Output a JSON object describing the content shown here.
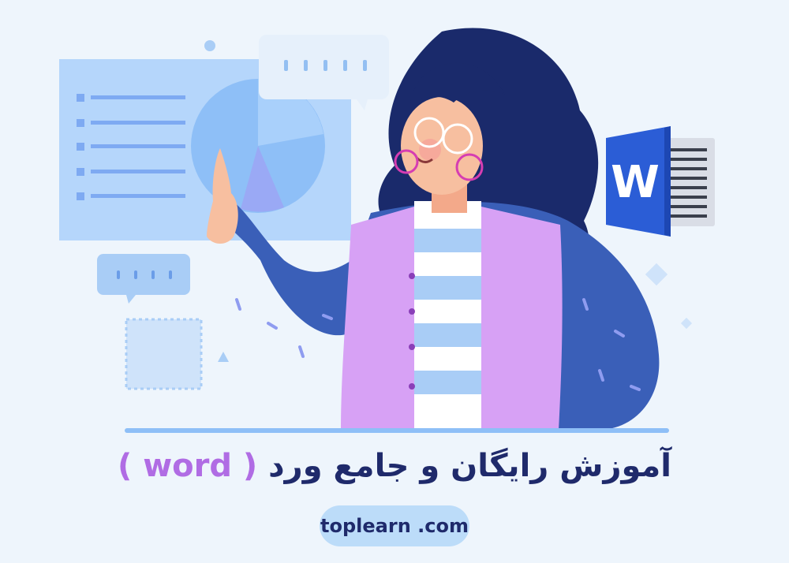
{
  "banner": {
    "title_main": "آموزش رایگان و جامع ورد",
    "title_word": "( word )",
    "site_url": "toplearn .com"
  },
  "icons": {
    "word_logo_letter": "W"
  },
  "colors": {
    "background": "#eef5fc",
    "title_text": "#1f2a6b",
    "word_accent": "#b06ce4",
    "url_pill": "#bcdcf9",
    "word_blue": "#2b5dd6",
    "vest_purple": "#d7a1f5",
    "jacket_blue": "#3a5fb8",
    "hair_navy": "#1a2a6b"
  }
}
